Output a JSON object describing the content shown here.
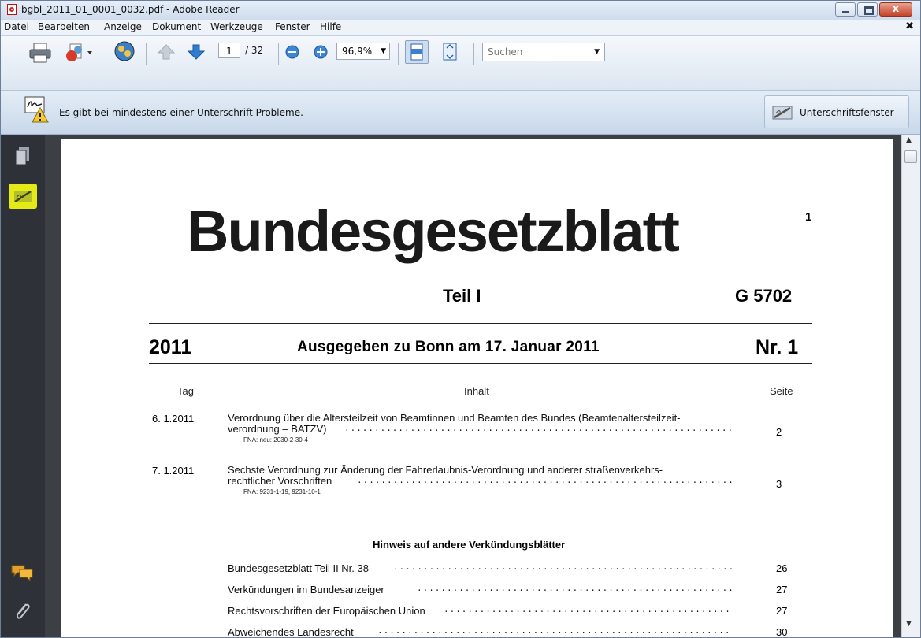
{
  "window": {
    "title": "bgbl_2011_01_0001_0032.pdf - Adobe Reader",
    "close_glyph": "x"
  },
  "menu": {
    "items": [
      "Datei",
      "Bearbeiten",
      "Anzeige",
      "Dokument",
      "Werkzeuge",
      "Fenster",
      "Hilfe"
    ],
    "close_doc_glyph": "✖"
  },
  "toolbar": {
    "page_current": "1",
    "page_total": "/ 32",
    "zoom": "96,9%",
    "search_placeholder": "Suchen",
    "icons": [
      "print-icon",
      "create-icon",
      "collaborate-icon",
      "prev-page-icon",
      "next-page-icon",
      "zoom-out-icon",
      "zoom-in-icon",
      "fit-width-icon",
      "fit-page-icon"
    ]
  },
  "message_bar": {
    "text": "Es gibt bei mindestens einer Unterschrift Probleme.",
    "button_label": "Unterschriftsfenster"
  },
  "left_panel": {
    "icons": [
      "pages-icon",
      "signatures-icon",
      "comments-icon",
      "attachments-icon"
    ]
  },
  "document": {
    "masthead": "Bundesgesetzblatt",
    "page_number": "1",
    "part": "Teil I",
    "code": "G 5702",
    "year": "2011",
    "issued": "Ausgegeben zu Bonn am 17. Januar 2011",
    "issue_no": "Nr. 1",
    "headers": {
      "date": "Tag",
      "contents": "Inhalt",
      "page": "Seite"
    },
    "entries": [
      {
        "date": "6. 1.2011",
        "line1": "Verordnung über die Altersteilzeit von Beamtinnen und Beamten des Bundes (Beamtenaltersteilzeit-",
        "line2": "verordnung – BATZV)",
        "fna": "FNA: neu: 2030-2-30-4",
        "page": "2"
      },
      {
        "date": "7. 1.2011",
        "line1": "Sechste Verordnung zur Änderung der Fahrerlaubnis-Verordnung und anderer straßenverkehrs-",
        "line2": "rechtlicher Vorschriften",
        "fna": "FNA: 9231-1-19, 9231-10-1",
        "page": "3"
      }
    ],
    "notice_title": "Hinweis auf andere Verkündungsblätter",
    "references": [
      {
        "label": "Bundesgesetzblatt Teil II Nr. 38",
        "page": "26"
      },
      {
        "label": "Verkündungen im Bundesanzeiger",
        "page": "27"
      },
      {
        "label": "Rechtsvorschriften der Europäischen Union",
        "page": "27"
      },
      {
        "label": "Abweichendes Landesrecht",
        "page": "30"
      }
    ]
  }
}
